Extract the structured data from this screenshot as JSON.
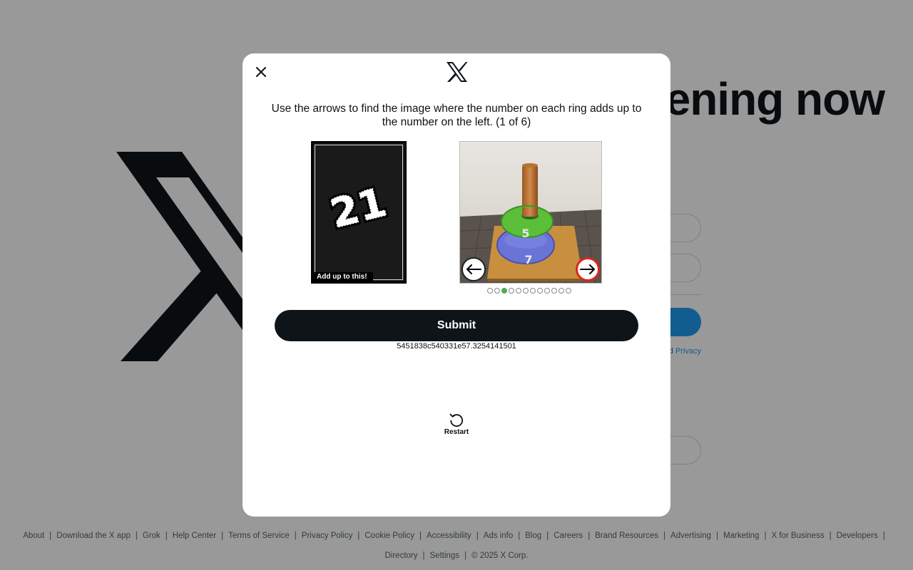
{
  "background": {
    "headline": "Happening now",
    "terms_link": "Privacy",
    "footer": {
      "line1": [
        "About",
        "Download the X app",
        "Grok",
        "Help Center",
        "Terms of Service",
        "Privacy Policy",
        "Cookie Policy",
        "Accessibility",
        "Ads info",
        "Blog",
        "Careers",
        "Brand Resources",
        "Advertising",
        "Marketing",
        "X for Business",
        "Developers"
      ],
      "line2": [
        "Directory",
        "Settings"
      ],
      "copyright": "© 2025 X Corp."
    }
  },
  "modal": {
    "close_icon": "close-icon",
    "logo_icon": "x-logo-icon",
    "instructions": "Use the arrows to find the image where the number on each ring adds up to the number on the left. (1 of 6)",
    "target": {
      "number": "21",
      "caption": "Add up to this!"
    },
    "puzzle": {
      "ring_labels": [
        "5",
        "7"
      ],
      "ring_colors": [
        "#5bbf3a",
        "#6a73d6"
      ],
      "left_arrow_icon": "arrow-left-icon",
      "right_arrow_icon": "arrow-right-icon",
      "page_count": 12,
      "active_page": 3
    },
    "submit_label": "Submit",
    "session_id": "5451838c540331e57.3254141501",
    "restart_label": "Restart",
    "restart_icon": "restart-icon"
  },
  "colors": {
    "overlay": "#000000",
    "submit_bg": "#0f1419",
    "brand_blue": "#1d9bf0",
    "active_dot": "#4caf50",
    "right_arrow_ring": "#e0241c"
  }
}
